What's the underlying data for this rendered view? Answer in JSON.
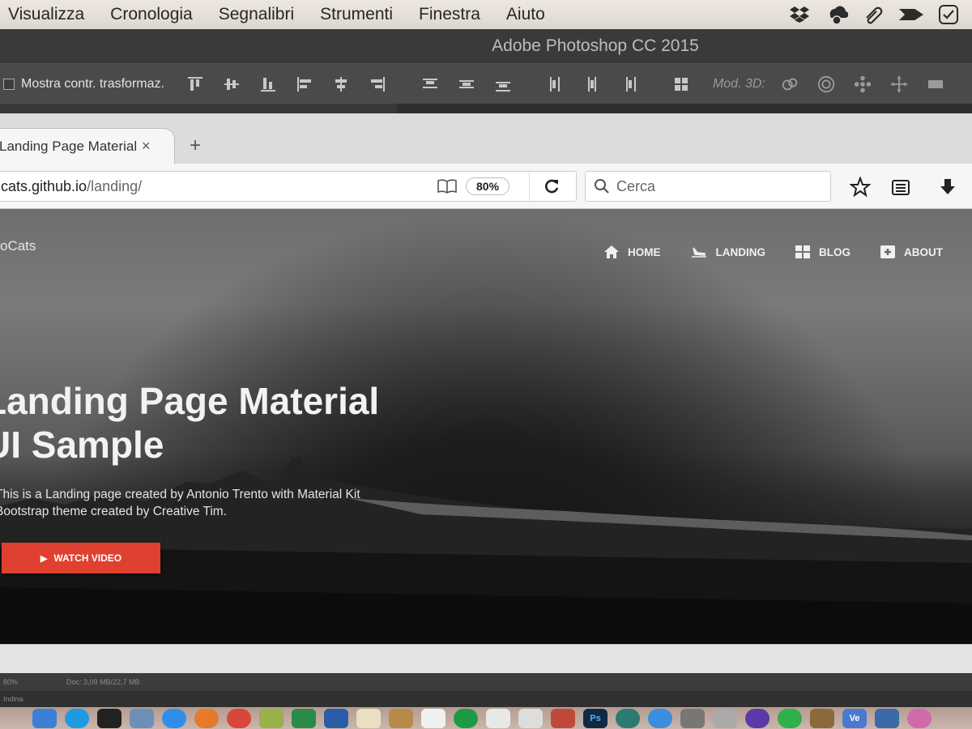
{
  "menubar": {
    "items": [
      "Visualizza",
      "Cronologia",
      "Segnalibri",
      "Strumenti",
      "Finestra",
      "Aiuto"
    ],
    "status_icons": [
      "dropbox-icon",
      "cloud-sync-icon",
      "paperclip-icon",
      "arrow-icon",
      "checkmark-icon"
    ]
  },
  "photoshop": {
    "title": "Adobe Photoshop CC 2015",
    "options": {
      "transform_label": "Mostra contr. trasformaz.",
      "mode_3d_label": "Mod. 3D:"
    },
    "status": {
      "zoom": "80%",
      "doc": "Doc: 3,09 MB/22,7 MB"
    },
    "panel_label": "Indina"
  },
  "browser": {
    "tab": {
      "title": "Landing Page Material UI Sample",
      "close": "×",
      "new_tab": "+"
    },
    "url": {
      "host": "cats.github.io",
      "path": "/landing/"
    },
    "zoom": "80%",
    "search": {
      "placeholder": "Cerca"
    }
  },
  "page": {
    "brand": "oCats",
    "nav": [
      {
        "label": "HOME",
        "icon": "home-icon"
      },
      {
        "label": "LANDING",
        "icon": "landing-icon"
      },
      {
        "label": "BLOG",
        "icon": "grid-icon"
      },
      {
        "label": "ABOUT",
        "icon": "about-icon"
      }
    ],
    "hero": {
      "title_line1": "Landing Page Material",
      "title_line2": "UI Sample",
      "subtitle_line1": "This is a Landing page created by Antonio Trento with Material Kit",
      "subtitle_line2": "Bootstrap theme created by Creative Tim.",
      "cta_label": "WATCH VIDEO",
      "cta_color": "#e0402f"
    }
  },
  "dock": {
    "apps": [
      "finder-icon",
      "skype-icon",
      "terminal-icon",
      "preview-icon",
      "safari-icon",
      "firefox-icon",
      "chrome-icon",
      "app-icon",
      "excel-icon",
      "word-icon",
      "notes-icon",
      "app-icon",
      "calendar-icon",
      "spotify-icon",
      "photos-icon",
      "text-icon",
      "app-icon",
      "photoshop-icon",
      "app-icon",
      "appstore-icon",
      "app-icon",
      "app-icon",
      "app-icon",
      "whatsapp-icon",
      "app-icon",
      "vscode-icon",
      "virtualbox-icon",
      "app-icon"
    ],
    "photoshop_label": "Ps",
    "vs_label": "Ve"
  }
}
